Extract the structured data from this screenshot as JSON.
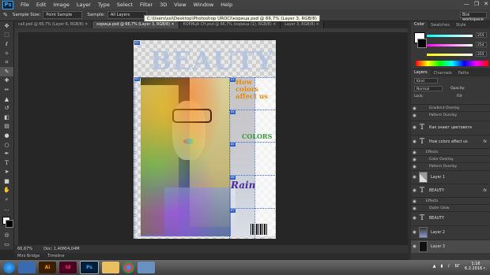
{
  "app": {
    "logo": "Ps"
  },
  "menu": [
    "File",
    "Edit",
    "Image",
    "Layer",
    "Type",
    "Select",
    "Filter",
    "3D",
    "View",
    "Window",
    "Help"
  ],
  "window_controls": [
    "—",
    "❐",
    "✕"
  ],
  "options_bar": {
    "sample_size_label": "Sample Size:",
    "sample_size_value": "Point Sample",
    "sample_label": "Sample:",
    "sample_value": "All Layers",
    "workspace": "Все workspace"
  },
  "path_tooltip": "C:\\Users\\ssi\\Desktop\\Photoshop UROCI\\корица.psd @ 66,7% (Layer 3, RGB/8)",
  "tabs": [
    {
      "label": "call.psd @ 66,7% (Layer 6, RGB/8) ✕",
      "active": false
    },
    {
      "label": "корица.psd @ 66,7% (Layer 3, RGB/8) ✕",
      "active": true
    },
    {
      "label": "КОРИЦА СН.psd @ 66,7% (корица (1), RGB/8) ✕",
      "active": false
    },
    {
      "label": "Layer 3, RGB/8) ✕",
      "active": false
    }
  ],
  "canvas": {
    "title_text": "BEAUTY",
    "how_colors": "How colors affect us",
    "colors_word": "COLORS",
    "rain_word": "Rain",
    "tagline": "..."
  },
  "slices": [
    "01",
    "02",
    "03",
    "04",
    "05",
    "06",
    "07"
  ],
  "status": {
    "zoom": "66,67%",
    "doc": "Doc: 1,40M/4,04M"
  },
  "mini_tabs": [
    "Mini Bridge",
    "Timeline"
  ],
  "panels": {
    "color_tabs": [
      "Color",
      "Swatches",
      "Style"
    ],
    "color_values": {
      "r": "255",
      "g": "254",
      "b": "255"
    },
    "layers_tabs": [
      "Layers",
      "Channels",
      "Paths"
    ],
    "kind": "Kind",
    "blend": "Normal",
    "opacity_label": "Opacity:",
    "lock_label": "Lock:",
    "fill_label": "Fill:",
    "layers": [
      {
        "type": "effect",
        "label": "Gradient Overlay"
      },
      {
        "type": "effect",
        "label": "Pattern Overlay"
      },
      {
        "type": "text",
        "label": "Как знают цветовете",
        "fx": false
      },
      {
        "type": "text",
        "label": "How colors  affect us",
        "fx": true
      },
      {
        "type": "effect",
        "label": "Effects"
      },
      {
        "type": "effect",
        "label": "Color Overlay"
      },
      {
        "type": "effect",
        "label": "Pattern Overlay"
      },
      {
        "type": "image",
        "label": "Layer 1",
        "fx": false
      },
      {
        "type": "text",
        "label": "BEAUTY",
        "fx": true
      },
      {
        "type": "effect",
        "label": "Effects"
      },
      {
        "type": "effect",
        "label": "Outer Glow"
      },
      {
        "type": "text",
        "label": "BEAUTY",
        "fx": false
      },
      {
        "type": "image",
        "label": "Layer 2",
        "fx": false
      },
      {
        "type": "image",
        "label": "Layer 3",
        "fx": false
      }
    ]
  },
  "taskbar": {
    "apps": [
      "",
      "Ai",
      "Id",
      "Ps",
      "",
      "",
      ""
    ],
    "time": "1:16",
    "date": "6.2.2016 г.",
    "lang": "БГ"
  }
}
